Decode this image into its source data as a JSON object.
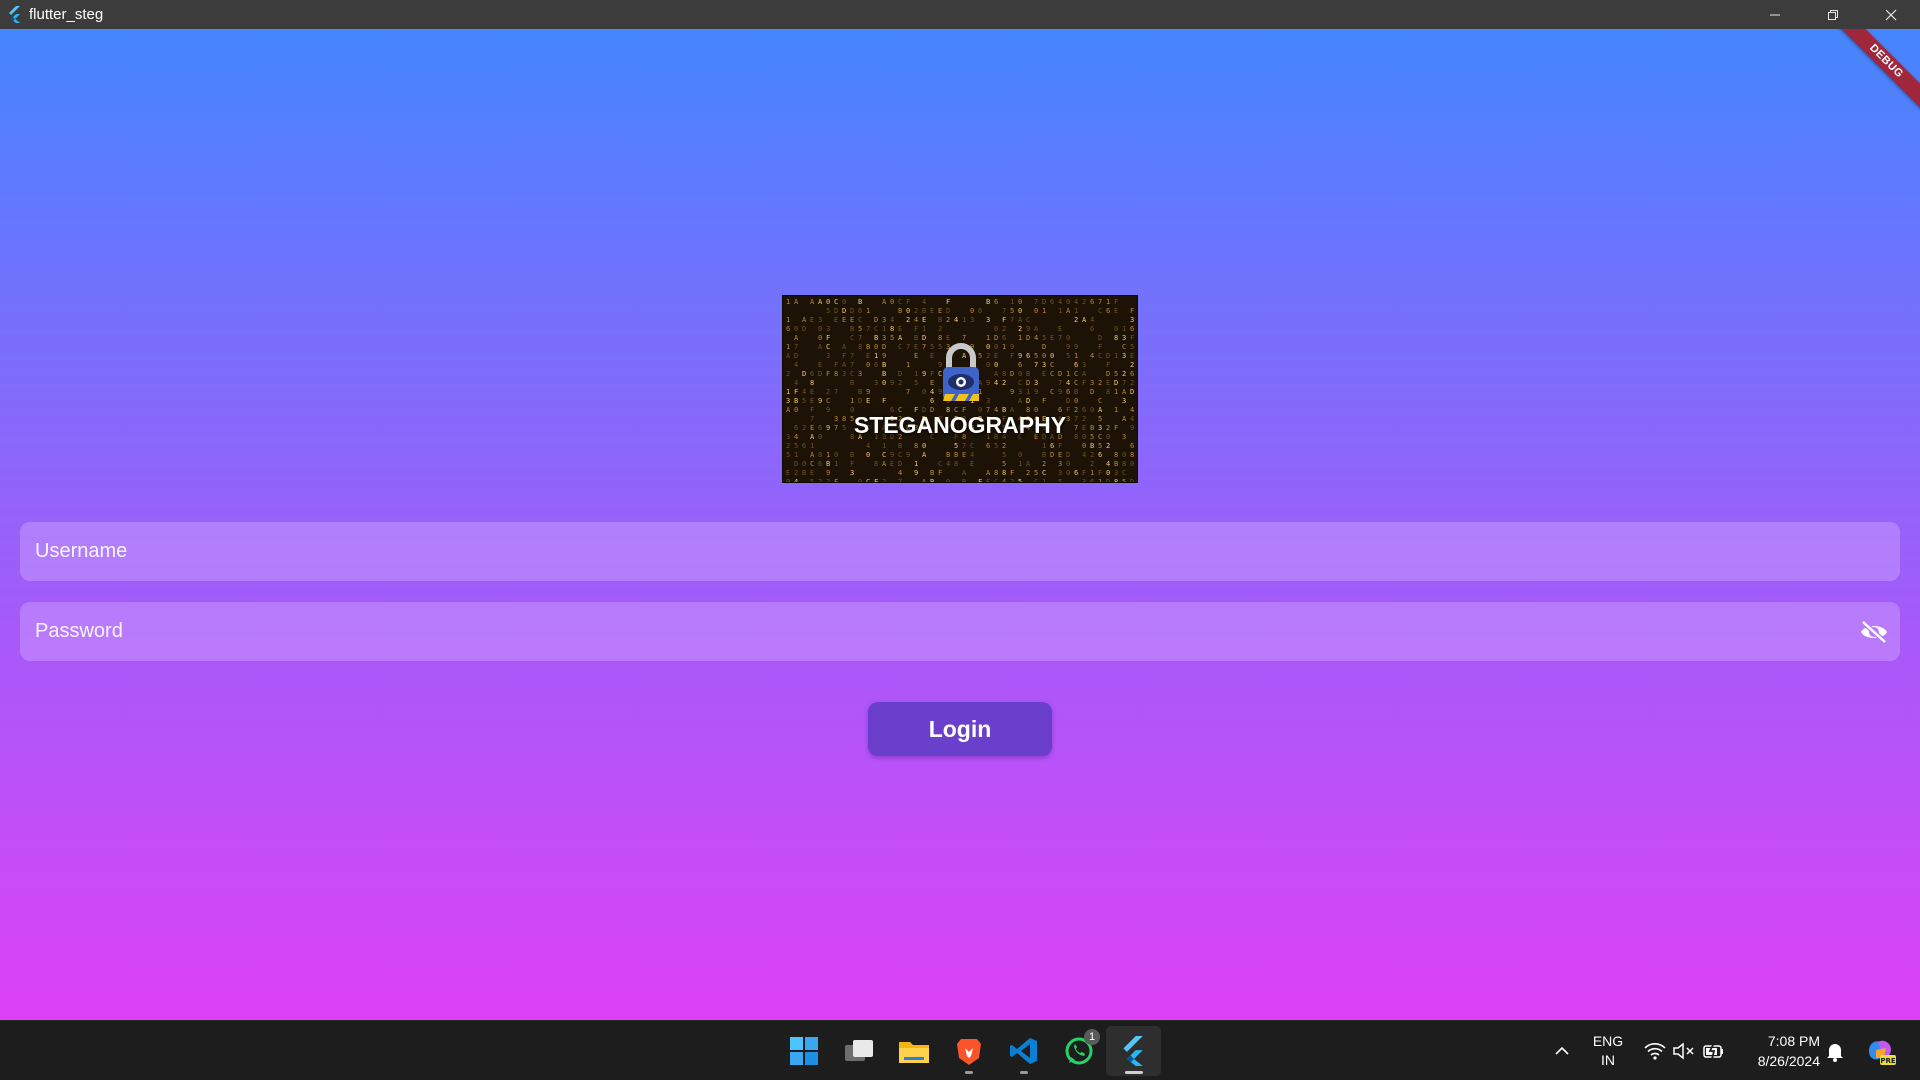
{
  "window": {
    "title": "flutter_steg",
    "debug_label": "DEBUG"
  },
  "logo": {
    "text": "STEGANOGRAPHY"
  },
  "form": {
    "username_placeholder": "Username",
    "password_placeholder": "Password",
    "login_label": "Login"
  },
  "taskbar": {
    "apps": [
      "start-icon",
      "task-view-icon",
      "file-explorer-icon",
      "brave-browser-icon",
      "vscode-icon",
      "whatsapp-icon",
      "flutter-icon"
    ],
    "whatsapp_badge": "1",
    "language_line1": "ENG",
    "language_line2": "IN",
    "time": "7:08 PM",
    "date": "8/26/2024"
  },
  "colors": {
    "gradient_top": "#4486fd",
    "gradient_bottom": "#dd40f5",
    "login_button": "#6a3fcb",
    "debug_banner": "#a0263b"
  }
}
